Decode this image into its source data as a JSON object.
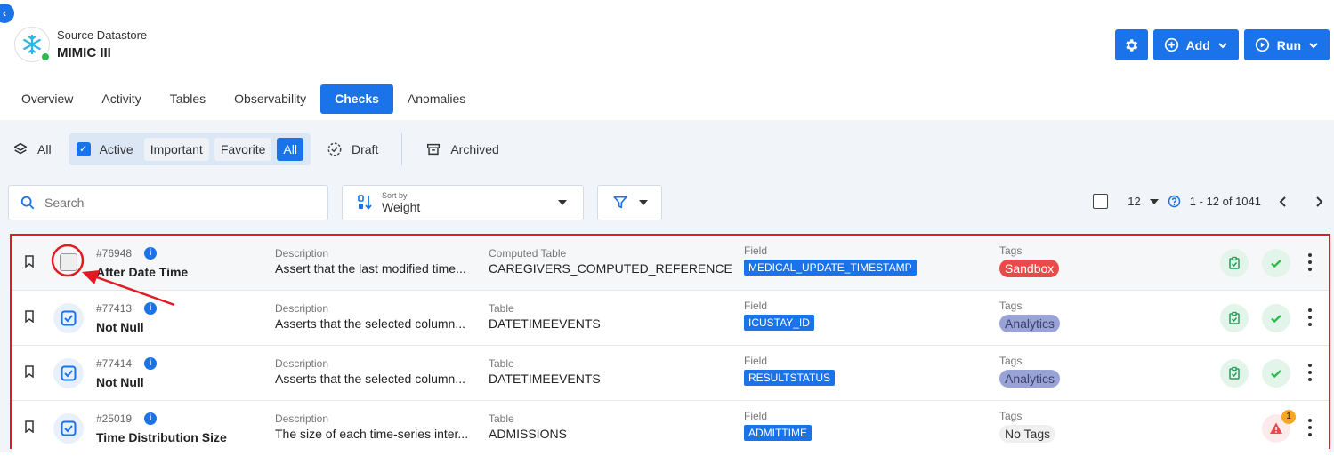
{
  "datastore": {
    "label": "Source Datastore",
    "name": "MIMIC III"
  },
  "top_actions": {
    "add_label": "Add",
    "run_label": "Run"
  },
  "tabs": [
    {
      "label": "Overview"
    },
    {
      "label": "Activity"
    },
    {
      "label": "Tables"
    },
    {
      "label": "Observability"
    },
    {
      "label": "Checks",
      "active": true
    },
    {
      "label": "Anomalies"
    }
  ],
  "status_filter": {
    "all_label": "All",
    "active_label": "Active",
    "segments": [
      "Important",
      "Favorite",
      "All"
    ],
    "selected_segment": "All",
    "draft_label": "Draft",
    "archived_label": "Archived"
  },
  "search": {
    "placeholder": "Search"
  },
  "sort": {
    "caption": "Sort by",
    "value": "Weight"
  },
  "pagination": {
    "page_size": "12",
    "range": "1 - 12 of 1041"
  },
  "checks": [
    {
      "id": "#76948",
      "name": "After Date Time",
      "desc_label": "Description",
      "description": "Assert that the last modified time...",
      "table_label": "Computed Table",
      "table": "CAREGIVERS_COMPUTED_REFERENCE",
      "field_label": "Field",
      "field": "MEDICAL_UPDATE_TIMESTAMP",
      "tags_label": "Tags",
      "tag": "Sandbox",
      "tag_type": "sandbox",
      "status": "ok"
    },
    {
      "id": "#77413",
      "name": "Not Null",
      "desc_label": "Description",
      "description": "Asserts that the selected column...",
      "table_label": "Table",
      "table": "DATETIMEEVENTS",
      "field_label": "Field",
      "field": "ICUSTAY_ID",
      "tags_label": "Tags",
      "tag": "Analytics",
      "tag_type": "analytics",
      "status": "ok"
    },
    {
      "id": "#77414",
      "name": "Not Null",
      "desc_label": "Description",
      "description": "Asserts that the selected column...",
      "table_label": "Table",
      "table": "DATETIMEEVENTS",
      "field_label": "Field",
      "field": "RESULTSTATUS",
      "tags_label": "Tags",
      "tag": "Analytics",
      "tag_type": "analytics",
      "status": "ok"
    },
    {
      "id": "#25019",
      "name": "Time Distribution Size",
      "desc_label": "Description",
      "description": "The size of each time-series inter...",
      "table_label": "Table",
      "table": "ADMISSIONS",
      "field_label": "Field",
      "field": "ADMITTIME",
      "tags_label": "Tags",
      "tag": "No Tags",
      "tag_type": "notags",
      "status": "warning",
      "anomaly_count": "1"
    }
  ],
  "colors": {
    "accent": "#1a73e8",
    "highlight": "#e01b22",
    "success": "#2dbb4e",
    "warning": "#f5a623"
  }
}
